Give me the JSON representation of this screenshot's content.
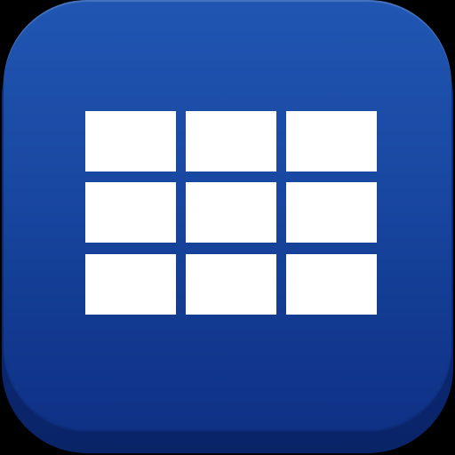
{
  "icon": {
    "name": "grid-view-app-icon",
    "symbol": "3x3-grid-icon",
    "colors": {
      "background": "#000000",
      "face_top": "#2056b2",
      "face_bottom": "#0f3186",
      "base": "#0c2a78",
      "tile": "#ffffff"
    },
    "grid": {
      "rows": 3,
      "columns": 3
    }
  }
}
